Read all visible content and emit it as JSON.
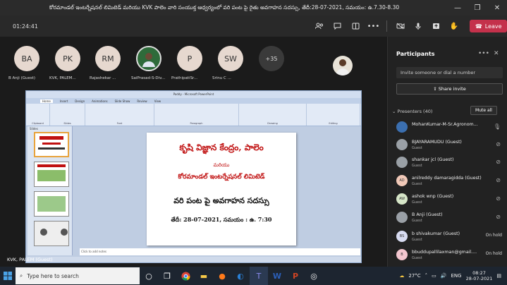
{
  "window": {
    "title": "కోరమాండల్ ఇంటర్నేషనల్ లిమిటెడ్ మరియు KVK పాలెం వారి సంయుక్త ఆధ్వర్యంలో వరి పంట పై రైతు అవగాహన సదస్సు, తేదీ:28-07-2021, సమయం: ఉ.7.30-8.30"
  },
  "toolbar": {
    "timer": "01:24:41",
    "leave_label": "Leave"
  },
  "stage": {
    "avatars": [
      {
        "initials": "BA",
        "name": "B Anji (Guest)"
      },
      {
        "initials": "PK",
        "name": "KVK, PALEM..."
      },
      {
        "initials": "RM",
        "name": "Rajashekar ..."
      },
      {
        "initials": "",
        "name": "SaiPrasad-S-Div..."
      },
      {
        "initials": "P",
        "name": "PrathipatiSr..."
      },
      {
        "initials": "SW",
        "name": "Srinu C ..."
      }
    ],
    "more_count": "+35",
    "self_label": "KVK, PALEM (Guest)"
  },
  "shared": {
    "window_title": "Paddy - Microsoft PowerPoint",
    "tabs": [
      "Home",
      "Insert",
      "Design",
      "Animations",
      "Slide Show",
      "Review",
      "View"
    ],
    "ribbon_groups": [
      "Clipboard",
      "Slides",
      "Font",
      "Paragraph",
      "Drawing",
      "Editing"
    ],
    "slides_tab": "Slides",
    "notes_placeholder": "Click to add notes",
    "slide": {
      "line1": "కృషి విజ్ఞాన కేంద్రం, పాలెం",
      "line2": "మరియు",
      "line3": "కోరమాండల్ ఇంటర్నేషనల్ లిమిటెడ్",
      "line4": "వరి పంట పై అవగాహన సదస్సు",
      "line5": "తేదీ: 28-07-2021, సమయం : ఉ. 7:30"
    }
  },
  "panel": {
    "title": "Participants",
    "invite_placeholder": "Invite someone or dial a number",
    "share_invite": "Share invite",
    "presenters_label": "Presenters (40)",
    "mute_all": "Mute all",
    "participants": [
      {
        "initials": "",
        "name": "MohanKumar-M-Sr.Agronom...",
        "role": "",
        "state": ""
      },
      {
        "initials": "",
        "name": "BJAYARAMUDU (Guest)",
        "role": "Guest",
        "state": ""
      },
      {
        "initials": "",
        "name": "shankar jcl (Guest)",
        "role": "Guest",
        "state": ""
      },
      {
        "initials": "AD",
        "name": "anilreddy damaragidda (Guest)",
        "role": "Guest",
        "state": ""
      },
      {
        "initials": "AW",
        "name": "ashok wnp (Guest)",
        "role": "Guest",
        "state": ""
      },
      {
        "initials": "",
        "name": "B Anji (Guest)",
        "role": "Guest",
        "state": ""
      },
      {
        "initials": "BS",
        "name": "b shivakumar (Guest)",
        "role": "Guest",
        "state": "On hold"
      },
      {
        "initials": "B",
        "name": "bbuddupallilaxman@gmail....",
        "role": "Guest",
        "state": "On hold"
      }
    ]
  },
  "taskbar": {
    "search_placeholder": "Type here to search",
    "weather": "27°C",
    "language": "ENG",
    "time": "08:27",
    "date": "28-07-2021"
  },
  "colors": {
    "leave": "#c4314b",
    "slide_text": "#c01010"
  }
}
